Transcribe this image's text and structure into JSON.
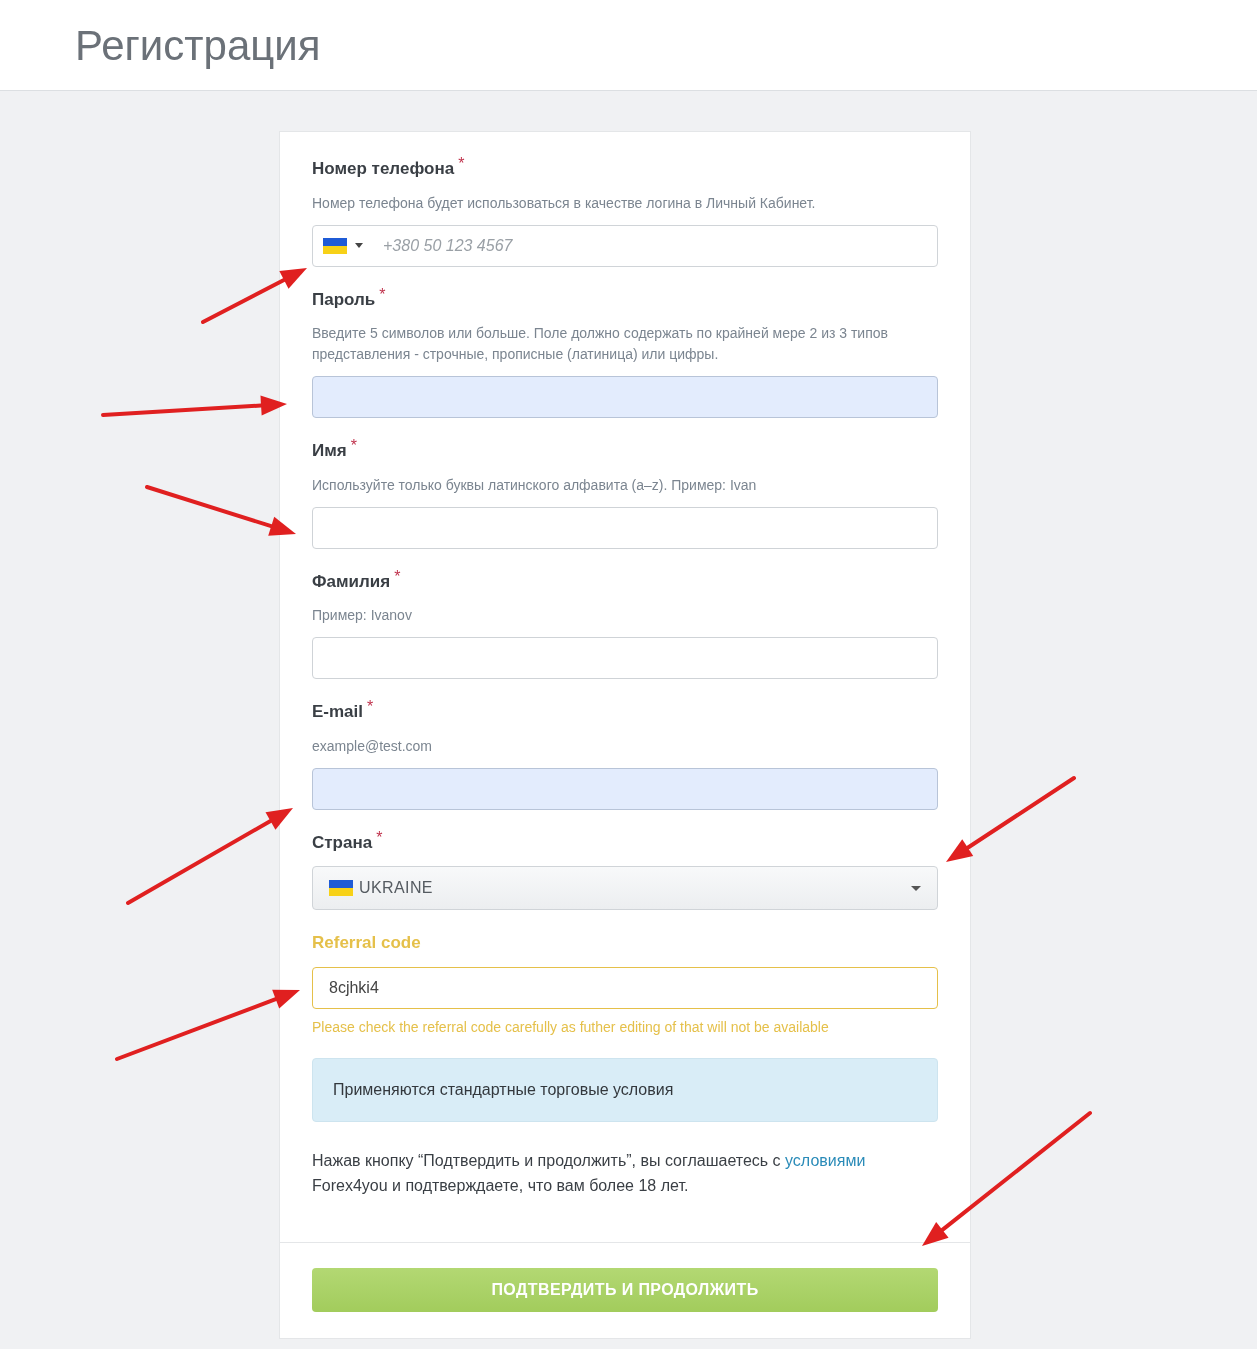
{
  "page_title": "Регистрация",
  "fields": [
    {
      "kind": "phone",
      "label": "Номер телефона",
      "required": "*",
      "hint": "Номер телефона будет использоваться в качестве логина в Личный Кабинет.",
      "placeholder": "+380 50 123 4567",
      "autofilled": false
    },
    {
      "kind": "password",
      "label": "Пароль",
      "required": "*",
      "hint": "Введите 5 символов или больше. Поле должно содержать по крайней мере 2 из 3 типов представления - строчные, прописные (латиница) или цифры.",
      "autofilled": true
    },
    {
      "kind": "text",
      "label": "Имя",
      "required": "*",
      "hint": "Используйте только буквы латинского алфавита (a–z). Пример: Ivan",
      "autofilled": false
    },
    {
      "kind": "text",
      "label": "Фамилия",
      "required": "*",
      "hint": "Пример: Ivanov",
      "autofilled": false
    },
    {
      "kind": "email",
      "label": "E-mail",
      "required": "*",
      "hint": "example@test.com",
      "autofilled": true
    },
    {
      "kind": "select",
      "label": "Страна",
      "required": "*",
      "value": "UKRAINE"
    },
    {
      "kind": "referral",
      "label": "Referral code",
      "value": "8cjhki4",
      "warning": "Please check the referral code carefully as futher editing of that will not be available"
    }
  ],
  "notice": "Применяются стандартные торговые условия",
  "agreement": {
    "before": "Нажав кнопку “Подтвердить и продолжить”, вы соглашаетесь с ",
    "link": "условиями",
    "after": " Forex4you и подтверждаете, что вам более 18 лет."
  },
  "submit": "ПОДТВЕРДИТЬ И ПРОДОЛЖИТЬ"
}
